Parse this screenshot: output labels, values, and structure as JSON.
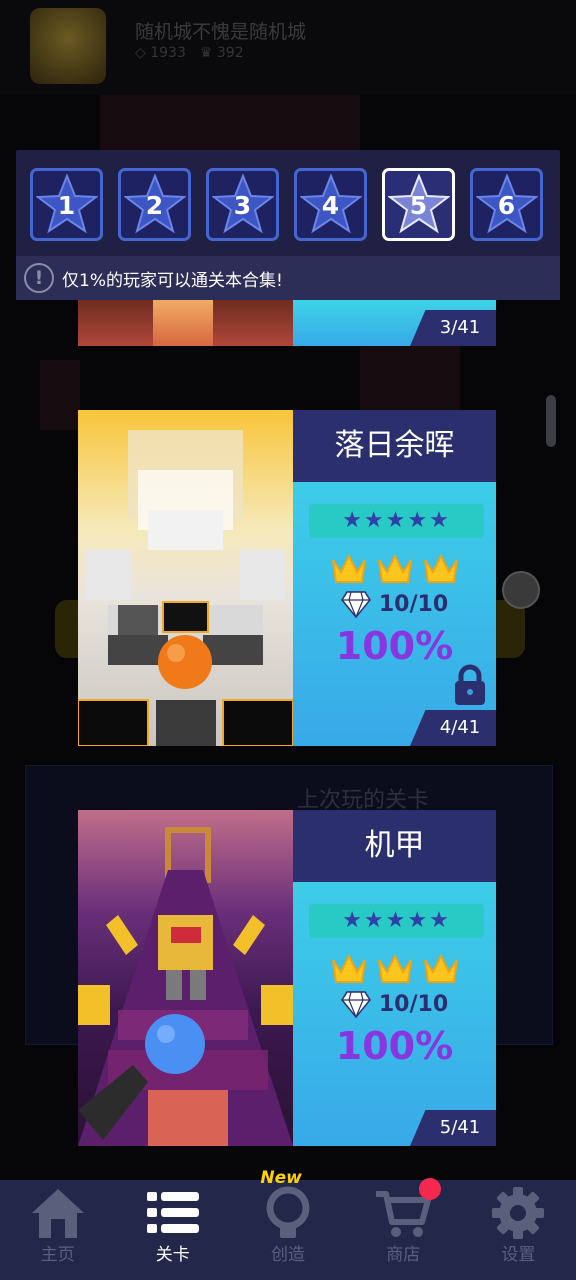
{
  "background": {
    "player_name": "随机城不愧是随机城",
    "gems": "1933",
    "crowns": "392",
    "last_played_label": "上次玩的关卡"
  },
  "star_tabs": [
    {
      "label": "1",
      "active": false
    },
    {
      "label": "2",
      "active": false
    },
    {
      "label": "3",
      "active": false
    },
    {
      "label": "4",
      "active": false
    },
    {
      "label": "5",
      "active": true
    },
    {
      "label": "6",
      "active": false
    }
  ],
  "notice": {
    "icon": "exclamation-icon",
    "text": "仅1%的玩家可以通关本合集!"
  },
  "levels": [
    {
      "count": "3/41"
    },
    {
      "title": "落日余晖",
      "stars": "★★★★★",
      "gems": "10/10",
      "percent": "100%",
      "count": "4/41",
      "locked": true
    },
    {
      "title": "机甲",
      "stars": "★★★★★",
      "gems": "10/10",
      "percent": "100%",
      "count": "5/41",
      "locked": false
    }
  ],
  "nav": {
    "home": "主页",
    "levels": "关卡",
    "create": "创造",
    "create_badge": "New",
    "shop": "商店",
    "settings": "设置"
  },
  "colors": {
    "accent_purple": "#8a36e0",
    "panel_navy": "#2b2f6e",
    "card_cyan": "#3ed7e8",
    "star_tab_border": "#4565d0",
    "shop_dot": "#f5294e"
  }
}
